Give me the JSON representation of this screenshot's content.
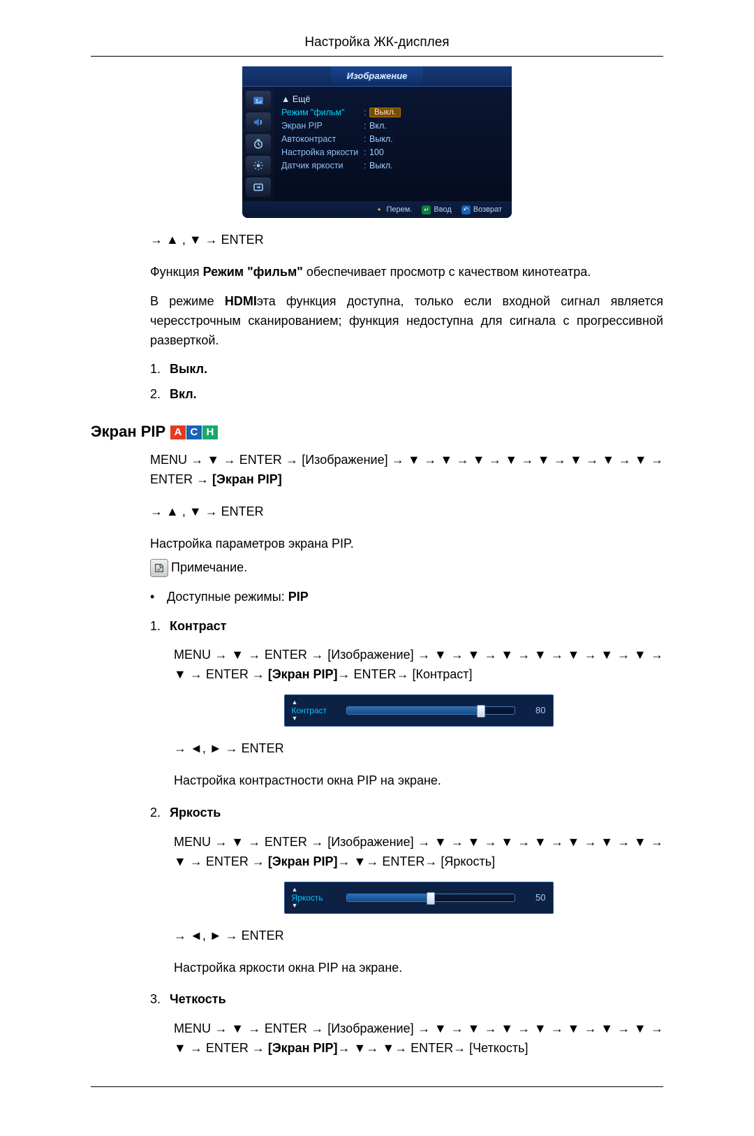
{
  "header": "Настройка ЖК-дисплея",
  "osd": {
    "title": "Изображение",
    "more": "▲  Ещё",
    "rows": [
      {
        "label": "Режим \"фильм\"",
        "value": "Выкл.",
        "highlight": true
      },
      {
        "label": "Экран PIP",
        "value": "Вкл."
      },
      {
        "label": "Автоконтраст",
        "value": "Выкл."
      },
      {
        "label": "Настройка яркости",
        "value": "100"
      },
      {
        "label": "Датчик яркости",
        "value": "Выкл."
      }
    ],
    "foot_move": "Перем.",
    "foot_enter": "Ввод",
    "foot_back": "Возврат"
  },
  "nav1": "→ ▲ , ▼ → ENTER",
  "para1_pre": "Функция ",
  "para1_bold": "Режим \"фильм\"",
  "para1_post": " обеспечивает просмотр с качеством кинотеатра.",
  "para2_a": "В режиме ",
  "para2_b": "HDMI",
  "para2_c": "эта функция доступна, только если входной сигнал является чересстрочным сканированием; функция недоступна для сигнала с прогрессивной разверткой.",
  "list1": {
    "n1": "1.",
    "v1": "Выкл.",
    "n2": "2.",
    "v2": "Вкл."
  },
  "sec_title": "Экран PIP",
  "badges": {
    "a": "A",
    "c": "C",
    "h": "H"
  },
  "path1_a": "MENU → ▼ → ENTER → ",
  "path1_b": "[Изображение]",
  "path1_c": " → ▼ → ▼ → ▼ → ▼ → ▼ → ▼ → ▼ → ▼ → ENTER → ",
  "path1_d": "[Экран PIP]",
  "nav2": "→ ▲ , ▼ → ENTER",
  "para3": "Настройка параметров экрана PIP.",
  "note": "Примечание.",
  "bullet_a": "Доступные режимы: ",
  "bullet_b": "PIP",
  "items": {
    "k": {
      "num": "1.",
      "title": "Контраст",
      "path_a": "MENU → ▼ → ENTER → ",
      "path_b": "[Изображение]",
      "path_c": " → ▼ → ▼ → ▼ → ▼ → ▼ → ▼ → ▼ → ▼ → ENTER → ",
      "path_d": "[Экран PIP]",
      "path_e": "→ ENTER→ ",
      "path_f": "[Контраст]",
      "slider_label": "Контраст",
      "slider_value": "80",
      "slider_pct": 80,
      "nav": "→ ◄, ► → ENTER",
      "desc": "Настройка контрастности окна PIP на экране."
    },
    "y": {
      "num": "2.",
      "title": "Яркость",
      "path_a": "MENU → ▼ → ENTER → ",
      "path_b": "[Изображение]",
      "path_c": " → ▼ → ▼ → ▼ → ▼ → ▼ → ▼ → ▼ → ▼ → ENTER → ",
      "path_d": "[Экран PIP]",
      "path_e": "→ ▼→ ENTER→ ",
      "path_f": "[Яркость]",
      "slider_label": "Яркость",
      "slider_value": "50",
      "slider_pct": 50,
      "nav": "→ ◄, ► → ENTER",
      "desc": "Настройка яркости окна PIP на экране."
    },
    "c": {
      "num": "3.",
      "title": "Четкость",
      "path_a": "MENU → ▼ → ENTER → ",
      "path_b": "[Изображение]",
      "path_c": " → ▼ → ▼ → ▼ → ▼ → ▼ → ▼ → ▼ → ▼ → ENTER → ",
      "path_d": "[Экран PIP]",
      "path_e": "→ ▼→ ▼→ ENTER→ ",
      "path_f": "[Четкость]"
    }
  }
}
